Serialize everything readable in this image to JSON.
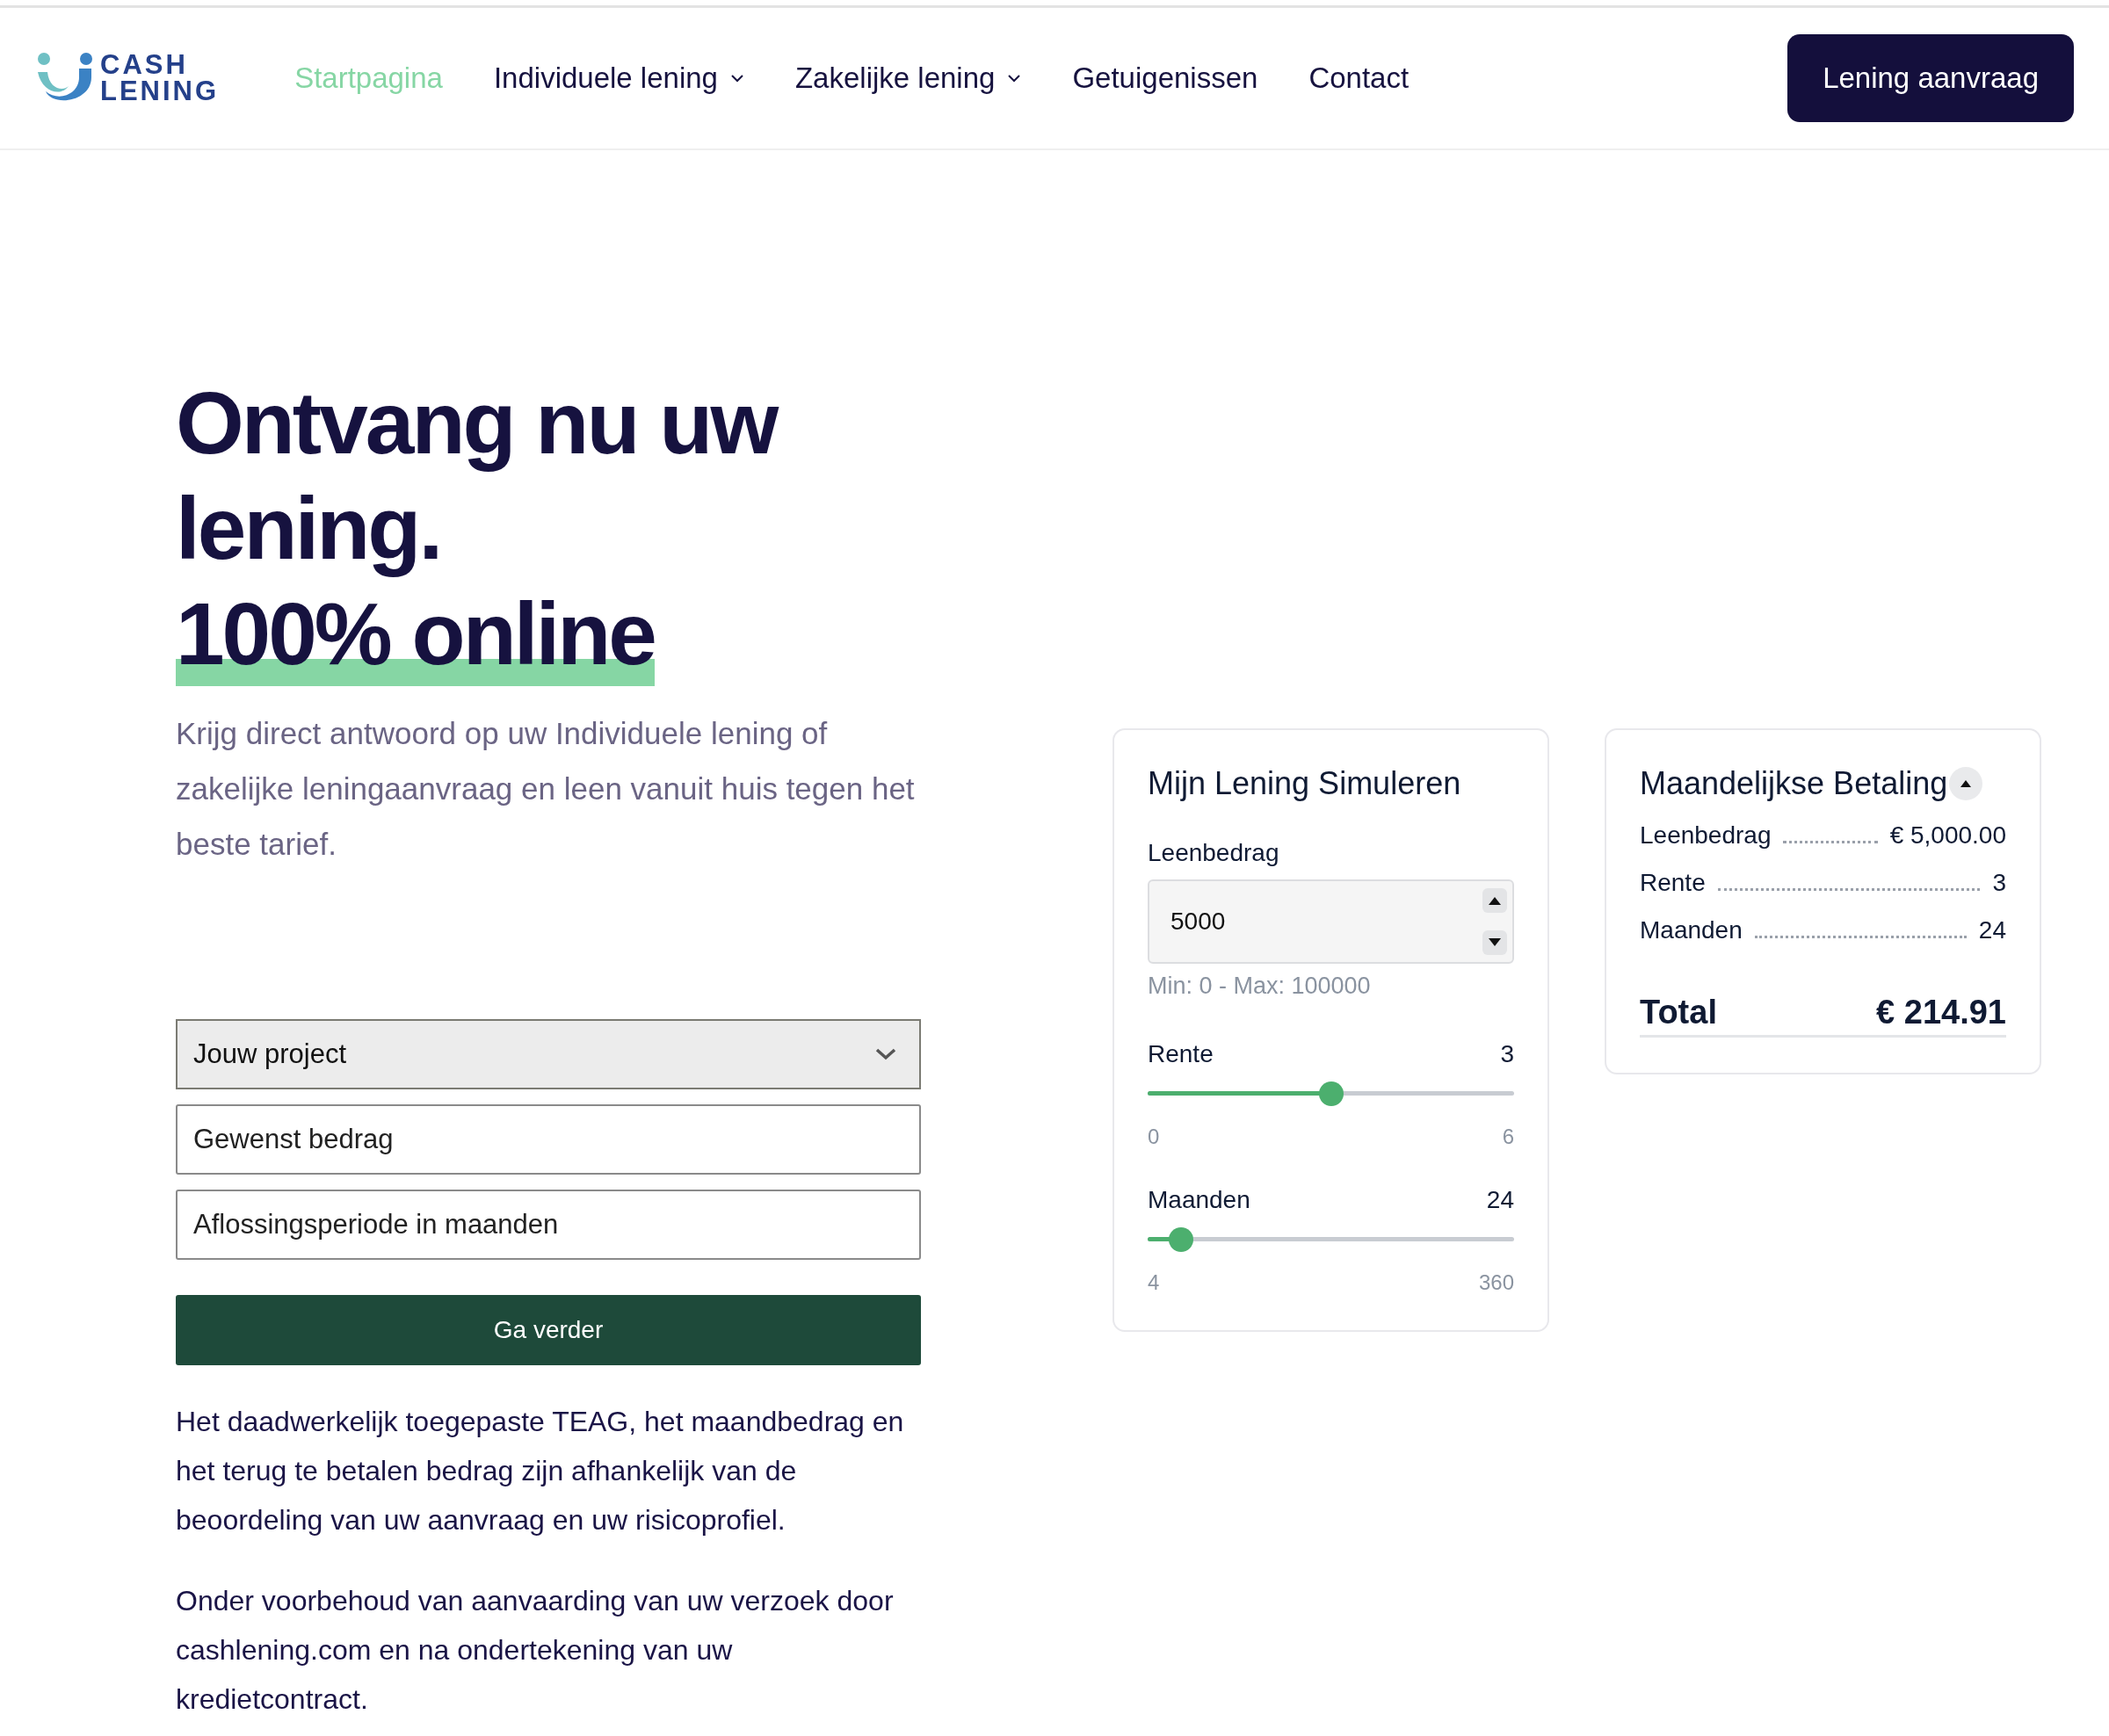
{
  "header": {
    "logo": {
      "line1": "CASH",
      "line2": "LENING"
    },
    "nav": [
      {
        "label": "Startpagina",
        "selected": true,
        "dropdown": false
      },
      {
        "label": "Individuele lening",
        "selected": false,
        "dropdown": true
      },
      {
        "label": "Zakelijke lening",
        "selected": false,
        "dropdown": true
      },
      {
        "label": "Getuigenissen",
        "selected": false,
        "dropdown": false
      },
      {
        "label": "Contact",
        "selected": false,
        "dropdown": false
      }
    ],
    "cta": "Lening aanvraag"
  },
  "hero": {
    "title_lines": [
      "Ontvang nu uw",
      "lening."
    ],
    "highlight": "100% online",
    "intro": "Krijg direct antwoord op uw Individuele lening of zakelijke leningaanvraag en leen vanuit huis tegen het beste tarief."
  },
  "form": {
    "select": {
      "value": "Jouw project"
    },
    "fields": [
      {
        "placeholder": "Gewenst bedrag"
      },
      {
        "placeholder": "Aflossingsperiode in maanden"
      }
    ],
    "submit": "Ga verder",
    "notes": [
      "Het daadwerkelijk toegepaste TEAG, het maandbedrag en het terug te betalen bedrag zijn afhankelijk van de beoordeling van uw aanvraag en uw risicoprofiel.",
      "Onder voorbehoud van aanvaarding van uw verzoek door cashlening.com en na ondertekening van uw kredietcontract."
    ]
  },
  "simulator": {
    "title": "Mijn Lening Simuleren",
    "amount": {
      "label": "Leenbedrag",
      "value": "5000",
      "hint": "Min: 0 - Max: 100000"
    },
    "sliders": [
      {
        "label": "Rente",
        "reading": "3",
        "min": "0",
        "max": "6",
        "level": 0.5
      },
      {
        "label": "Maanden",
        "reading": "24",
        "min": "4",
        "max": "360",
        "level": 0.09
      }
    ]
  },
  "payment": {
    "title": "Maandelijkse Betaling",
    "expanded": true,
    "rows": [
      {
        "label": "Leenbedrag",
        "value": "€ 5,000.00"
      },
      {
        "label": "Rente",
        "value": "3"
      },
      {
        "label": "Maanden",
        "value": "24"
      }
    ],
    "total": {
      "label": "Total",
      "value": "€ 214.91"
    }
  }
}
